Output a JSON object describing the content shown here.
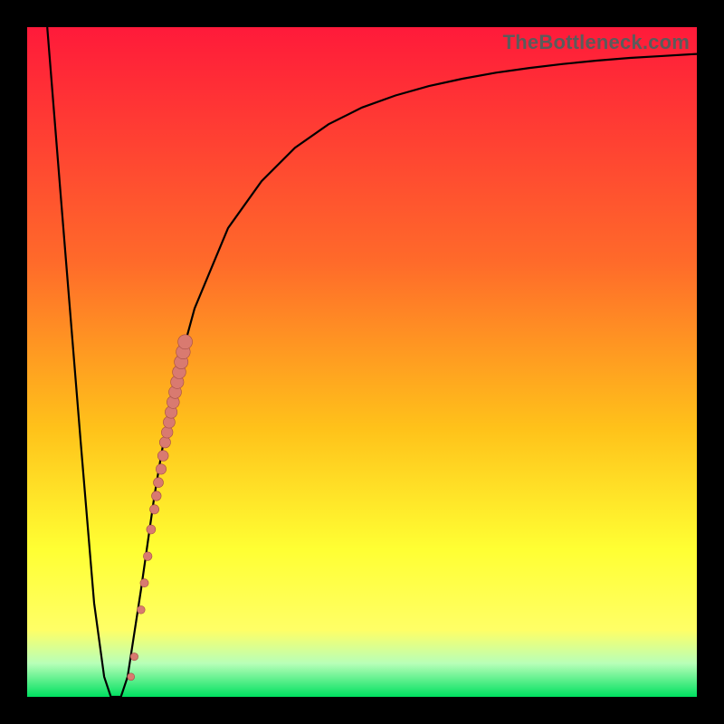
{
  "watermark": "TheBottleneck.com",
  "colors": {
    "frame": "#000000",
    "grad_top": "#ff1a3a",
    "grad_mid1": "#ff6a2a",
    "grad_mid2": "#ffc21a",
    "grad_mid3": "#ffff33",
    "grad_bottom_yellow": "#ffff66",
    "grad_green_pale": "#b8ffb8",
    "grad_green": "#00e060",
    "curve": "#000000",
    "marker_fill": "#d97a70",
    "marker_stroke": "#a34c45"
  },
  "chart_data": {
    "type": "line",
    "title": "",
    "xlabel": "",
    "ylabel": "",
    "xlim": [
      0,
      100
    ],
    "ylim": [
      0,
      100
    ],
    "curve": {
      "x": [
        3,
        5,
        8,
        10,
        11.5,
        12.5,
        14,
        15,
        17,
        19,
        20,
        22,
        25,
        30,
        35,
        40,
        45,
        50,
        55,
        60,
        65,
        70,
        75,
        80,
        85,
        90,
        95,
        100
      ],
      "y": [
        100,
        75,
        38,
        14,
        3,
        0,
        0,
        3,
        16,
        30,
        36,
        47,
        58,
        70,
        77,
        82,
        85.5,
        88,
        89.8,
        91.2,
        92.3,
        93.2,
        93.9,
        94.5,
        95,
        95.4,
        95.7,
        96
      ]
    },
    "markers": {
      "x": [
        15.5,
        16.0,
        17.0,
        17.5,
        18.0,
        18.5,
        19.0,
        19.3,
        19.6,
        20.0,
        20.3,
        20.6,
        20.9,
        21.2,
        21.5,
        21.8,
        22.1,
        22.4,
        22.7,
        23.0,
        23.3,
        23.6
      ],
      "y": [
        3.0,
        6.0,
        13.0,
        17.0,
        21.0,
        25.0,
        28.0,
        30.0,
        32.0,
        34.0,
        36.0,
        38.0,
        39.5,
        41.0,
        42.5,
        44.0,
        45.5,
        47.0,
        48.5,
        50.0,
        51.5,
        53.0
      ]
    }
  }
}
